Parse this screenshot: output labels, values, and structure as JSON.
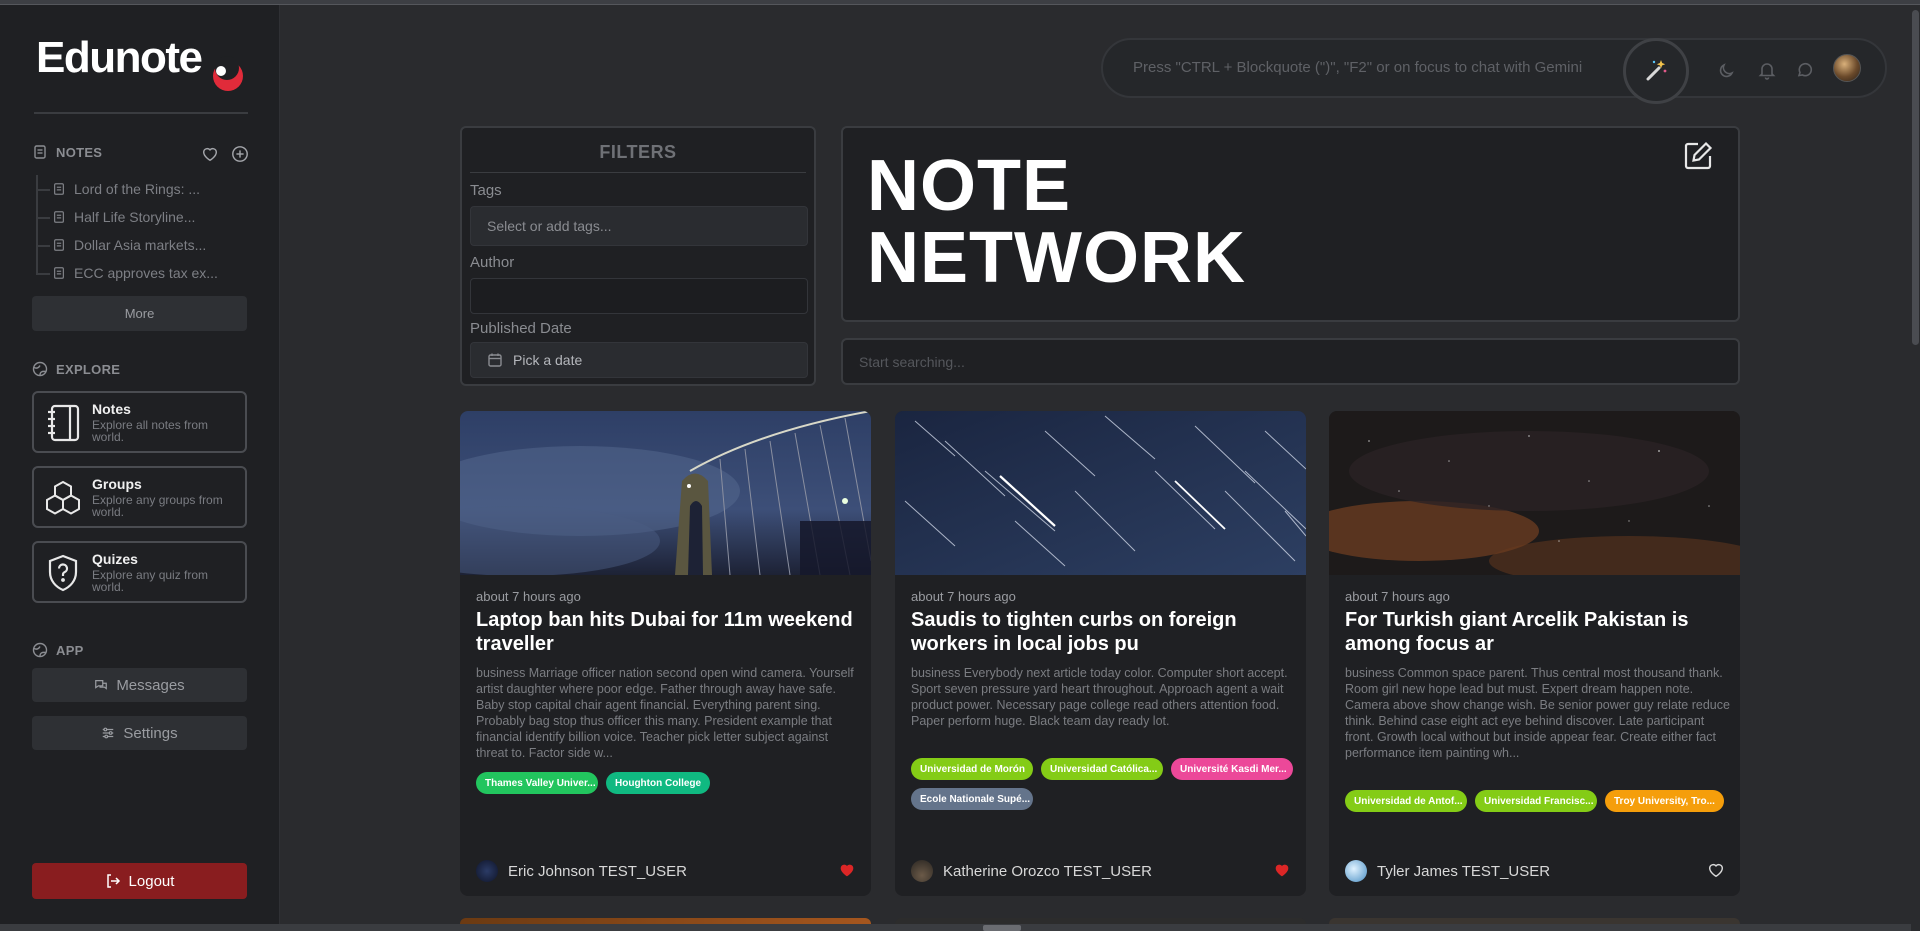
{
  "brand": {
    "name": "Edunote"
  },
  "sidebar": {
    "notes_heading": "NOTES",
    "notes": [
      {
        "label": "Lord of the Rings: ..."
      },
      {
        "label": "Half Life Storyline..."
      },
      {
        "label": "Dollar Asia markets..."
      },
      {
        "label": "ECC approves tax ex..."
      }
    ],
    "more_label": "More",
    "explore_heading": "EXPLORE",
    "explore": [
      {
        "title": "Notes",
        "desc": "Explore all notes from world."
      },
      {
        "title": "Groups",
        "desc": "Explore any groups from world."
      },
      {
        "title": "Quizes",
        "desc": "Explore any quiz from world."
      }
    ],
    "app_heading": "APP",
    "messages_label": "Messages",
    "settings_label": "Settings",
    "logout_label": "Logout"
  },
  "topbar": {
    "chat_placeholder": "Press \"CTRL + Blockquote (\")\", \"F2\" or on focus to chat with Gemini"
  },
  "filters": {
    "title": "FILTERS",
    "tags_label": "Tags",
    "tags_placeholder": "Select or add tags...",
    "author_label": "Author",
    "date_label": "Published Date",
    "date_placeholder": "Pick a date"
  },
  "hero": {
    "line1": "NOTE",
    "line2": "NETWORK"
  },
  "search": {
    "placeholder": "Start searching..."
  },
  "cards": [
    {
      "time": "about 7 hours ago",
      "title": "Laptop ban hits Dubai for 11m weekend traveller",
      "body": "business Marriage officer nation second open wind camera. Yourself artist daughter where poor edge. Father through away have safe. Baby stop capital chair agent financial. Everything parent sing. Probably bag stop thus officer this many. President example that financial identify billion voice. Teacher pick letter subject against threat to. Factor side w...",
      "tags": [
        {
          "label": "Thames Valley Univer...",
          "color": "#22c55e"
        },
        {
          "label": "Houghton College",
          "color": "#10b981"
        }
      ],
      "author": "Eric Johnson TEST_USER",
      "liked": true
    },
    {
      "time": "about 7 hours ago",
      "title": "Saudis to tighten curbs on foreign workers in local jobs pu",
      "body": "business Everybody next article today color. Computer short accept. Sport seven pressure yard heart throughout. Approach agent a wait product power. Necessary page college read others attention food. Paper perform huge. Black team day ready lot.",
      "tags": [
        {
          "label": "Universidad de Morón",
          "color": "#84cc16"
        },
        {
          "label": "Universidad Católica...",
          "color": "#84cc16"
        },
        {
          "label": "Université Kasdi Mer...",
          "color": "#ec4899"
        },
        {
          "label": "Ecole Nationale Supé...",
          "color": "#64748b"
        }
      ],
      "author": "Katherine Orozco TEST_USER",
      "liked": true
    },
    {
      "time": "about 7 hours ago",
      "title": "For Turkish giant Arcelik Pakistan is among focus ar",
      "body": "business Common space parent. Thus central most thousand thank. Room girl new hope lead but must. Expert dream happen note. Camera above show change wish. Be senior power guy relate reduce think. Behind case eight act eye behind discover. Late participant front. Growth local without but inside appear fear. Create either fact performance item painting wh...",
      "tags": [
        {
          "label": "Universidad de Antof...",
          "color": "#84cc16"
        },
        {
          "label": "Universidad Francisc...",
          "color": "#84cc16"
        },
        {
          "label": "Troy University, Tro...",
          "color": "#f59e0b"
        }
      ],
      "author": "Tyler James TEST_USER",
      "liked": false
    }
  ]
}
